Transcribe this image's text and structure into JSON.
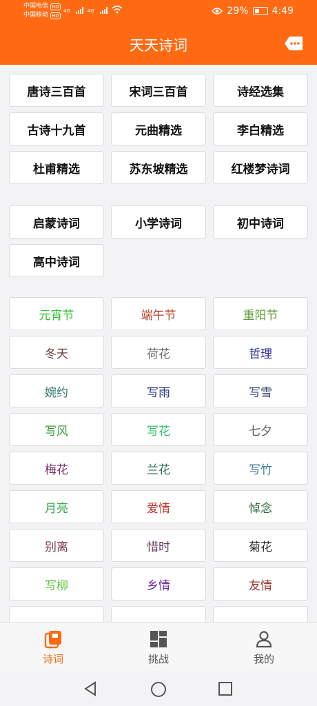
{
  "status": {
    "carrier1": "中国电信",
    "carrier2": "中国移动",
    "hd": "HD",
    "net": "4G",
    "battery": "29%",
    "time": "4:49"
  },
  "header": {
    "title": "天天诗词",
    "more_icon": "more-dots-icon"
  },
  "collections": [
    "唐诗三百首",
    "宋词三百首",
    "诗经选集",
    "古诗十九首",
    "元曲精选",
    "李白精选",
    "杜甫精选",
    "苏东坡精选",
    "红楼梦诗词"
  ],
  "school": [
    "启蒙诗词",
    "小学诗词",
    "初中诗词",
    "高中诗词"
  ],
  "topics": [
    {
      "label": "元宵节",
      "color": "#2ec12e"
    },
    {
      "label": "端午节",
      "color": "#b5402a"
    },
    {
      "label": "重阳节",
      "color": "#5a9a2e"
    },
    {
      "label": "冬天",
      "color": "#6a4040"
    },
    {
      "label": "荷花",
      "color": "#6a6a6a"
    },
    {
      "label": "哲理",
      "color": "#30309a"
    },
    {
      "label": "婉约",
      "color": "#2e7a6a"
    },
    {
      "label": "写雨",
      "color": "#25357a"
    },
    {
      "label": "写雪",
      "color": "#3a4a6a"
    },
    {
      "label": "写风",
      "color": "#3a9a3a"
    },
    {
      "label": "写花",
      "color": "#2ec16a"
    },
    {
      "label": "七夕",
      "color": "#5a5a5a"
    },
    {
      "label": "梅花",
      "color": "#7a2a6a"
    },
    {
      "label": "兰花",
      "color": "#2a6a5a"
    },
    {
      "label": "写竹",
      "color": "#3a7a9a"
    },
    {
      "label": "月亮",
      "color": "#2ea84a"
    },
    {
      "label": "爱情",
      "color": "#c2302a"
    },
    {
      "label": "悼念",
      "color": "#2a6a3a"
    },
    {
      "label": "别离",
      "color": "#7a3a4a"
    },
    {
      "label": "惜时",
      "color": "#5a3a5a"
    },
    {
      "label": "菊花",
      "color": "#2a2a2a"
    },
    {
      "label": "写柳",
      "color": "#5ac13a"
    },
    {
      "label": "乡情",
      "color": "#6a2a9a"
    },
    {
      "label": "友情",
      "color": "#9a3a2a"
    },
    {
      "label": "",
      "color": "#333333"
    },
    {
      "label": "",
      "color": "#333333"
    },
    {
      "label": "",
      "color": "#333333"
    }
  ],
  "nav": [
    {
      "label": "诗词",
      "icon": "book-icon",
      "active": true
    },
    {
      "label": "挑战",
      "icon": "grid-icon",
      "active": false
    },
    {
      "label": "我的",
      "icon": "person-icon",
      "active": false
    }
  ],
  "colors": {
    "brand": "#ff6a13",
    "active_nav": "#ff6a13",
    "inactive_nav": "#555555"
  }
}
